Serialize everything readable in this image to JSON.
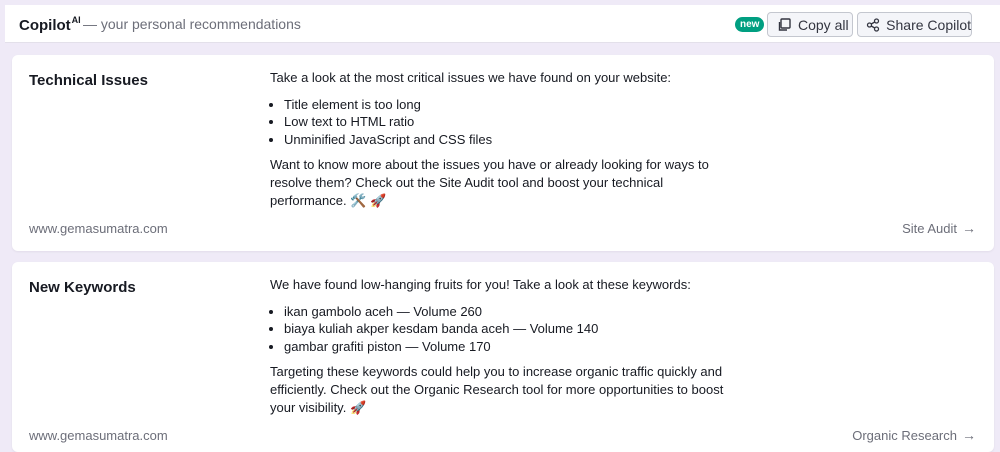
{
  "header": {
    "brand": "Copilot",
    "brand_sup": "AI",
    "tagline": "— your personal recommendations",
    "new_badge": "new",
    "copy_all_label": "Copy all",
    "share_label": "Share Copilot"
  },
  "cards": [
    {
      "title": "Technical Issues",
      "intro": "Take a look at the most critical issues we have found on your website:",
      "items": [
        "Title element is too long",
        "Low text to HTML ratio",
        "Unminified JavaScript and CSS files"
      ],
      "outro": "Want to know more about the issues you have or already looking for ways to resolve them? Check out the Site Audit tool and boost your technical performance. 🛠️ 🚀",
      "domain": "www.gemasumatra.com",
      "link_label": "Site Audit"
    },
    {
      "title": "New Keywords",
      "intro": "We have found low-hanging fruits for you! Take a look at these keywords:",
      "items": [
        "ikan gambolo aceh — Volume 260",
        "biaya kuliah akper kesdam banda aceh — Volume 140",
        "gambar grafiti piston — Volume 170"
      ],
      "outro": "Targeting these keywords could help you to increase organic traffic quickly and efficiently. Check out the Organic Research tool for more opportunities to boost your visibility. 🚀",
      "domain": "www.gemasumatra.com",
      "link_label": "Organic Research"
    }
  ],
  "icons": {
    "arrow": "→",
    "copy": "copy-icon",
    "share": "share-icon"
  },
  "colors": {
    "badge": "#009f81",
    "background": "#efeaf7"
  }
}
